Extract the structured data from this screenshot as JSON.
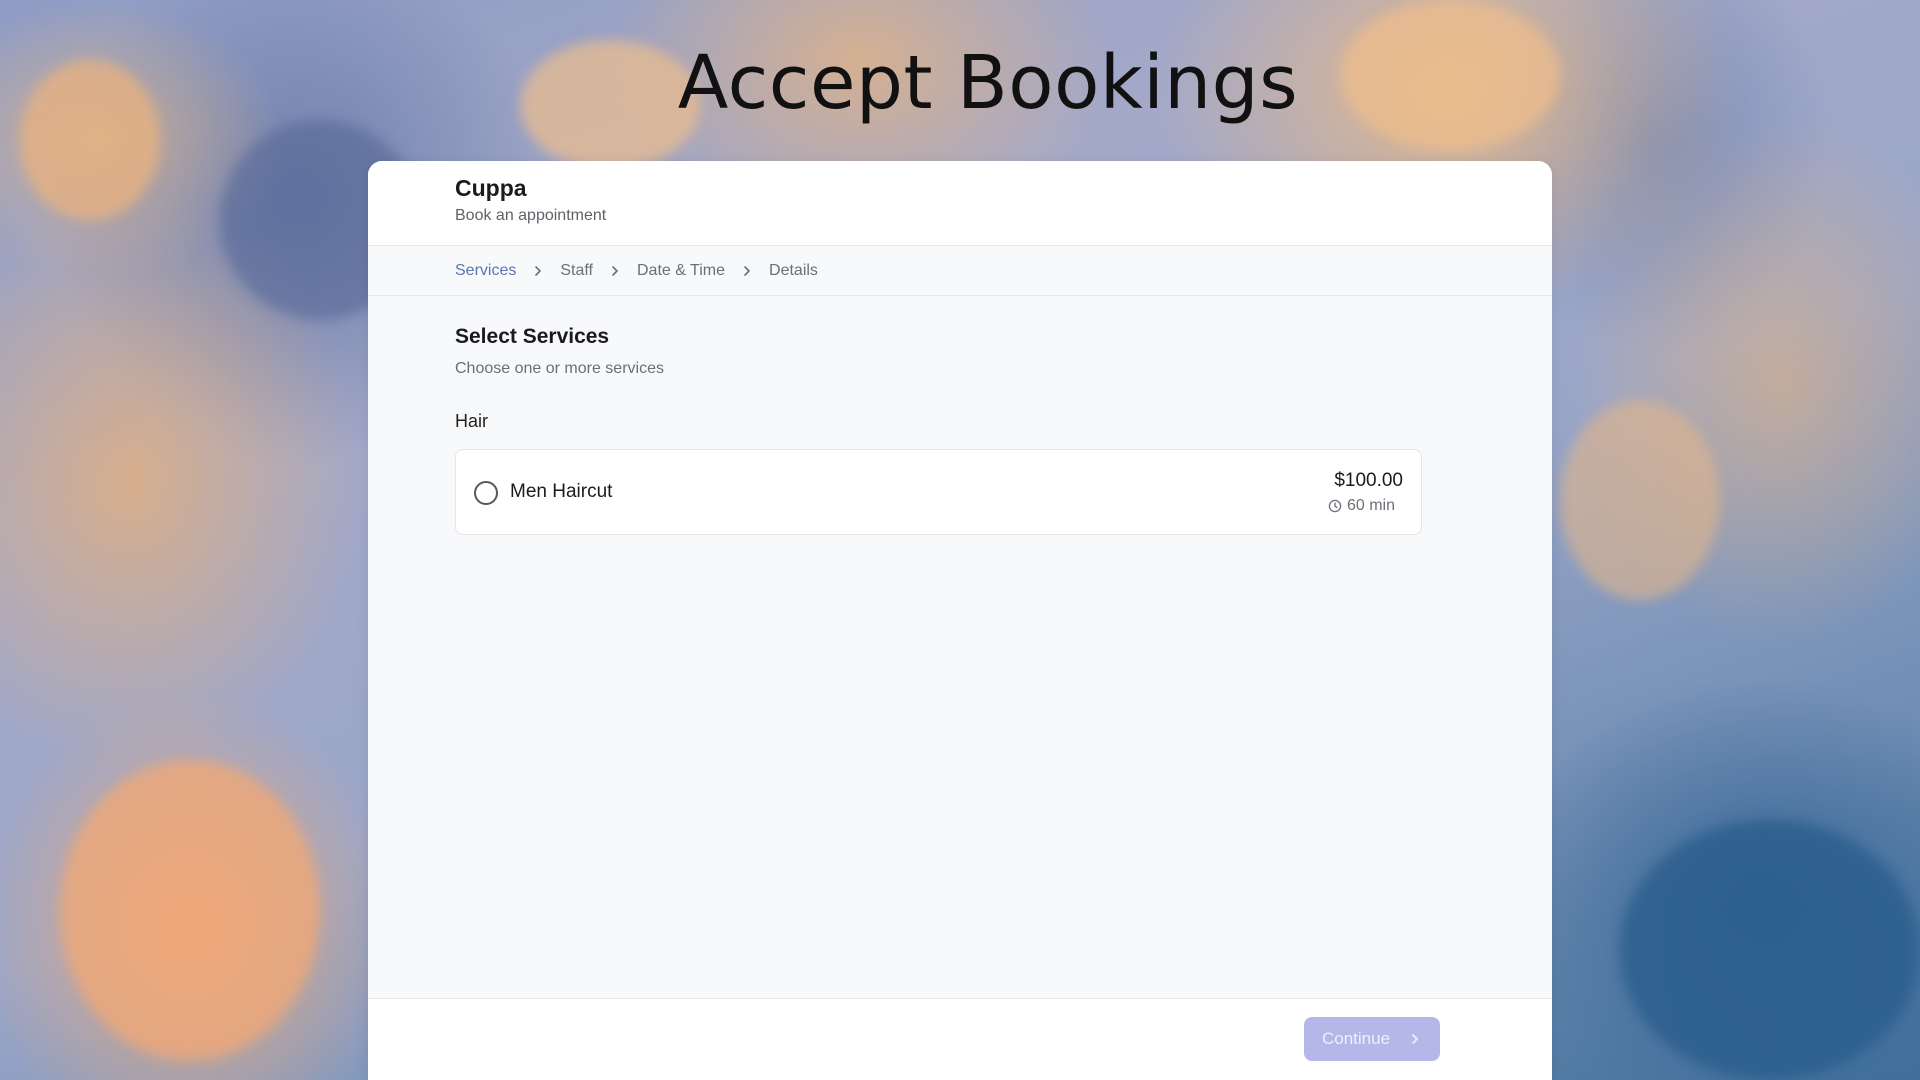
{
  "page": {
    "title": "Accept Bookings"
  },
  "business": {
    "name": "Cuppa",
    "subtitle": "Book an appointment"
  },
  "steps": [
    {
      "label": "Services",
      "active": true
    },
    {
      "label": "Staff",
      "active": false
    },
    {
      "label": "Date & Time",
      "active": false
    },
    {
      "label": "Details",
      "active": false
    }
  ],
  "section": {
    "title": "Select Services",
    "subtitle": "Choose one or more services"
  },
  "categories": [
    {
      "name": "Hair",
      "services": [
        {
          "name": "Men Haircut",
          "price": "$100.00",
          "duration": "60 min",
          "selected": false
        }
      ]
    }
  ],
  "footer": {
    "continue_label": "Continue"
  },
  "colors": {
    "accent": "#5c76b3",
    "button_disabled": "#b3b8e8"
  },
  "icons": {
    "step_separator": "chevron-right-icon",
    "duration": "clock-icon",
    "continue": "chevron-right-icon"
  }
}
